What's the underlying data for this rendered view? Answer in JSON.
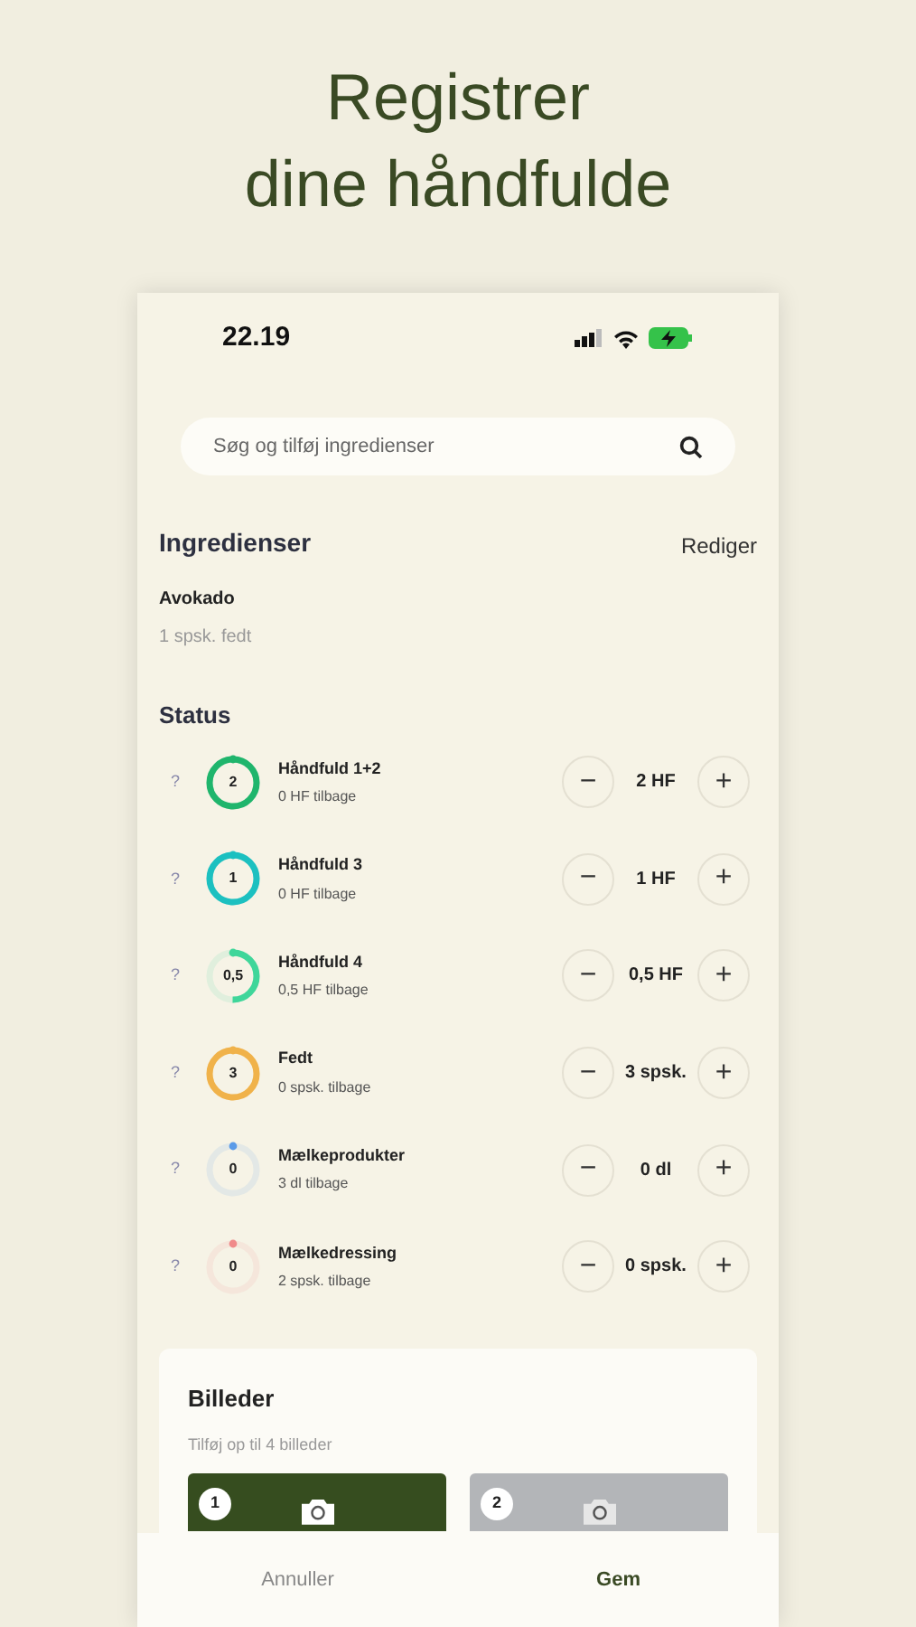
{
  "headline_lines": [
    "Registrer",
    "dine håndfulde"
  ],
  "status_bar": {
    "time": "22.19"
  },
  "search": {
    "placeholder": "Søg og tilføj ingredienser"
  },
  "ingredients": {
    "title": "Ingredienser",
    "edit": "Rediger",
    "items": [
      {
        "name": "Avokado",
        "amount": "1 spsk. fedt"
      }
    ]
  },
  "status": {
    "title": "Status",
    "rows": [
      {
        "help": "?",
        "ring_value": "2",
        "level": 1,
        "color": "#1fb56c",
        "name": "Håndfuld 1+2",
        "remaining": "0 HF tilbage",
        "minus": "−",
        "amount": "2 HF",
        "plus": "+"
      },
      {
        "help": "?",
        "ring_value": "1",
        "level": 1,
        "color": "#1cc0c0",
        "name": "Håndfuld 3",
        "remaining": "0 HF tilbage",
        "minus": "−",
        "amount": "1 HF",
        "plus": "+"
      },
      {
        "help": "?",
        "ring_value": "0,5",
        "level": 0.5,
        "color": "#3fd69a",
        "name": "Håndfuld 4",
        "remaining": "0,5 HF tilbage",
        "minus": "−",
        "amount": "0,5 HF",
        "plus": "+"
      },
      {
        "help": "?",
        "ring_value": "3",
        "level": 1,
        "color": "#f0b24a",
        "name": "Fedt",
        "remaining": "0 spsk. tilbage",
        "minus": "−",
        "amount": "3 spsk.",
        "plus": "+"
      },
      {
        "help": "?",
        "ring_value": "0",
        "level": 0,
        "color": "#5b9be8",
        "name": "Mælkeprodukter",
        "remaining": "3 dl tilbage",
        "minus": "−",
        "amount": "0 dl",
        "plus": "+"
      },
      {
        "help": "?",
        "ring_value": "0",
        "level": 0,
        "color": "#f08a8a",
        "name": "Mælkedressing",
        "remaining": "2 spsk. tilbage",
        "minus": "−",
        "amount": "0 spsk.",
        "plus": "+"
      }
    ]
  },
  "photos": {
    "title": "Billeder",
    "hint": "Tilføj op til 4 billeder",
    "slots": [
      {
        "number": "1",
        "filled": true
      },
      {
        "number": "2",
        "filled": false
      }
    ]
  },
  "bottom_bar": {
    "cancel": "Annuller",
    "save": "Gem"
  }
}
